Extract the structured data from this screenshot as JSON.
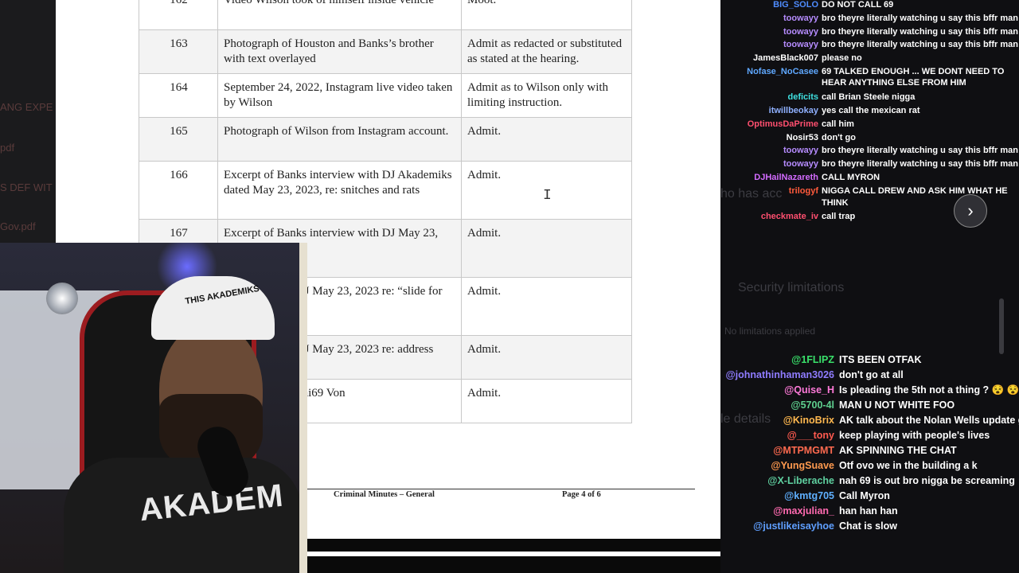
{
  "left_strip_fragments": [
    "ANG EXPE",
    "pdf",
    "S DEF WIT",
    "Gov.pdf"
  ],
  "exhibits": [
    {
      "num": "162",
      "description": "Video Wilson took of himself inside vehicle",
      "ruling": "Moot."
    },
    {
      "num": "163",
      "description": "Photograph of Houston and Banks’s brother with text overlayed",
      "ruling": "Admit as redacted or substituted as stated at the hearing."
    },
    {
      "num": "164",
      "description": "September 24, 2022, Instagram live video taken by Wilson",
      "ruling": "Admit as to Wilson only with limiting instruction."
    },
    {
      "num": "165",
      "description": "Photograph of Wilson from Instagram account.",
      "ruling": "Admit."
    },
    {
      "num": "166",
      "description": "Excerpt of Banks interview with DJ Akademiks dated May 23, 2023, re: snitches and rats",
      "ruling": "Admit."
    },
    {
      "num": "167",
      "description": "Excerpt of Banks interview with DJ May 23, 2023 re: NBA",
      "ruling": "Admit."
    },
    {
      "num": "",
      "description": "interview with DJ May 23, 2023 re: “slide for",
      "ruling": "Admit."
    },
    {
      "num": "",
      "description": "interview with DJ May 23, 2023 re: address",
      "ruling": "Admit."
    },
    {
      "num": "",
      "description": "excerpt of Tekashi69 Von",
      "ruling": "Admit."
    }
  ],
  "footer": {
    "left": "Criminal Minutes – General",
    "right": "Page 4 of 6"
  },
  "cam": {
    "hat_text": "THIS AKADEMIKS",
    "shirt_text": "AKADEM"
  },
  "ghost_text": [
    "ho has acc",
    "Security limitations",
    "No limitations applied",
    "le details"
  ],
  "chat_top": [
    {
      "user": "BIG_SOLO",
      "color": "#4f8cff",
      "msg": "DO NOT CALL 69"
    },
    {
      "user": "toowayy",
      "color": "#b68cff",
      "msg": "bro theyre literally watching u say this bffr man"
    },
    {
      "user": "toowayy",
      "color": "#b68cff",
      "msg": "bro theyre literally watching u say this bffr man"
    },
    {
      "user": "toowayy",
      "color": "#b68cff",
      "msg": "bro theyre literally watching u say this bffr man"
    },
    {
      "user": "JamesBlack007",
      "color": "#ffffff",
      "msg": "please no"
    },
    {
      "user": "Nofase_NoCasee",
      "color": "#5fa8ff",
      "msg": "69 TALKED ENOUGH ... WE DONT NEED TO"
    },
    {
      "user": "",
      "color": "#ffffff",
      "msg": "HEAR ANYTHING ELSE FROM HIM"
    },
    {
      "user": "deficits",
      "color": "#3fe0e0",
      "msg": "call Brian Steele nigga"
    },
    {
      "user": "itwillbeokay",
      "color": "#8fb0ff",
      "msg": "yes call the mexican rat"
    },
    {
      "user": "OptimusDaPrime",
      "color": "#ff4f6f",
      "msg": "call him"
    },
    {
      "user": "Nosir53",
      "color": "#ffffff",
      "msg": "don't go"
    },
    {
      "user": "toowayy",
      "color": "#b68cff",
      "msg": "bro theyre literally watching u say this bffr man"
    },
    {
      "user": "toowayy",
      "color": "#b68cff",
      "msg": "bro theyre literally watching u say this bffr man"
    },
    {
      "user": "DJHailNazareth",
      "color": "#d36bff",
      "msg": "CALL MYRON"
    },
    {
      "user": "trilogyf",
      "color": "#ff5a3c",
      "msg": "NIGGA CALL DREW AND ASK HIM WHAT HE"
    },
    {
      "user": "",
      "color": "#ffffff",
      "msg": "THINK"
    },
    {
      "user": "checkmate_iv",
      "color": "#ff4f6f",
      "msg": "call trap"
    }
  ],
  "chat_bottom": [
    {
      "user": "@1FLIPZ",
      "color": "#39e06a",
      "msg": "ITS BEEN OTFAK"
    },
    {
      "user": "@johnathinhaman3026",
      "color": "#8f7cff",
      "msg": "don't go at all"
    },
    {
      "user": "@Quise_H",
      "color": "#ff7ad9",
      "msg": "Is pleading the 5th not a thing ? 😵 😵"
    },
    {
      "user": "@5700-4l",
      "color": "#5fd08f",
      "msg": "MAN U NOT WHITE FOO"
    },
    {
      "user": "@KinoBrix",
      "color": "#ffb84f",
      "msg": "AK talk about the Nolan Wells update gang"
    },
    {
      "user": "@___tony",
      "color": "#ff5a4f",
      "msg": "keep playing with people's lives"
    },
    {
      "user": "@MTPMGMT",
      "color": "#ff6a4f",
      "msg": "AK SPINNING THE CHAT"
    },
    {
      "user": "@YungSuave",
      "color": "#ff9a4f",
      "msg": "Otf ovo we in the building a k"
    },
    {
      "user": "@X-Liberache",
      "color": "#5fd0a0",
      "msg": "nah 69 is out bro nigga be screaming"
    },
    {
      "user": "@kmtg705",
      "color": "#5fb0ff",
      "msg": "Call Myron"
    },
    {
      "user": "@maxjulian_",
      "color": "#ff6ab0",
      "msg": "han han han"
    },
    {
      "user": "@justlikeisayhoe",
      "color": "#5f9fff",
      "msg": "Chat is slow"
    }
  ],
  "nav_icon": "chevron-right-icon"
}
